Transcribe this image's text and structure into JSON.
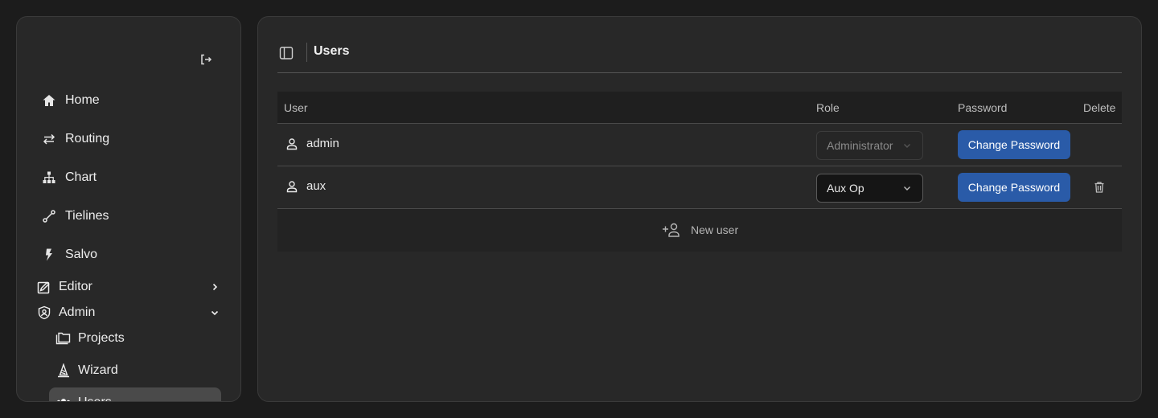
{
  "sidebar": {
    "logout_icon": "logout-icon",
    "items": [
      {
        "label": "Home",
        "icon": "home-icon"
      },
      {
        "label": "Routing",
        "icon": "routing-arrows-icon"
      },
      {
        "label": "Chart",
        "icon": "hierarchy-chart-icon"
      },
      {
        "label": "Tielines",
        "icon": "tieline-icon"
      },
      {
        "label": "Salvo",
        "icon": "lightning-icon"
      }
    ],
    "groups": [
      {
        "label": "Editor",
        "icon": "edit-square-icon",
        "expanded": false
      },
      {
        "label": "Admin",
        "icon": "shield-user-icon",
        "expanded": true
      }
    ],
    "admin_items": [
      {
        "label": "Projects",
        "icon": "folders-icon"
      },
      {
        "label": "Wizard",
        "icon": "wizard-icon"
      },
      {
        "label": "Users",
        "icon": "users-icon",
        "active": true
      }
    ]
  },
  "header": {
    "title": "Users",
    "toggle_icon": "sidebar-toggle-icon"
  },
  "table": {
    "columns": {
      "user": "User",
      "role": "Role",
      "password": "Password",
      "delete": "Delete"
    },
    "rows": [
      {
        "username": "admin",
        "role": "Administrator",
        "role_editable": false,
        "password_button": "Change Password",
        "deletable": false
      },
      {
        "username": "aux",
        "role": "Aux Op",
        "role_editable": true,
        "password_button": "Change Password",
        "deletable": true
      }
    ],
    "new_user_label": "New user"
  },
  "colors": {
    "background": "#1c1c1c",
    "panel": "#282828",
    "accent_button": "#2a5ba8",
    "active_nav": "#4a4a4a"
  }
}
